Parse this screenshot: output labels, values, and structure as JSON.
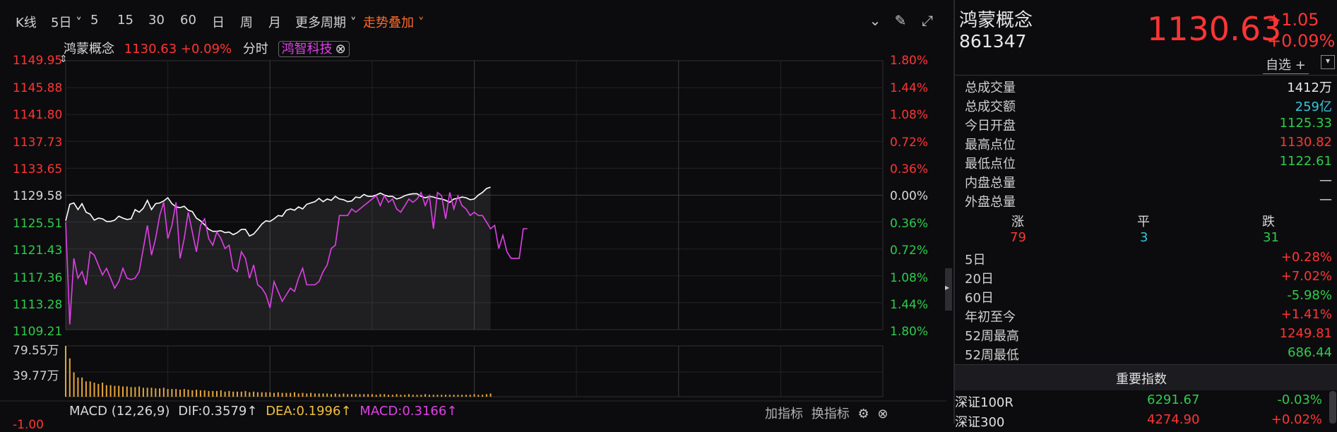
{
  "toolbar": {
    "kline": "K线",
    "period_5d": "5日",
    "items": [
      "5",
      "15",
      "30",
      "60",
      "日",
      "周",
      "月"
    ],
    "more_periods": "更多周期",
    "trend_overlay": "走势叠加"
  },
  "chart_header": {
    "name": "鸿蒙概念",
    "price_change": "1130.63 +0.09%",
    "mode": "分时",
    "overlay_tag": "鸿智科技"
  },
  "price_axis_left": [
    "1149.95",
    "1145.88",
    "1141.80",
    "1137.73",
    "1133.65",
    "1129.58",
    "1125.51",
    "1121.43",
    "1117.36",
    "1113.28",
    "1109.21"
  ],
  "price_axis_right": [
    "1.80%",
    "1.44%",
    "1.08%",
    "0.72%",
    "0.36%",
    "0.00%",
    "0.36%",
    "0.72%",
    "1.08%",
    "1.44%",
    "1.80%"
  ],
  "volume_axis": [
    "79.55万",
    "39.77万"
  ],
  "macd_axis_partial": "-1.00",
  "macd": {
    "name": "MACD",
    "params": "(12,26,9)",
    "dif": "DIF:0.3579",
    "dea": "DEA:0.1996",
    "macd_val": "MACD:0.3166",
    "arrow": "↑",
    "add_indicator": "加指标",
    "switch_indicator": "换指标"
  },
  "quote": {
    "name": "鸿蒙概念",
    "code": "861347",
    "price": "1130.63",
    "change": "+1.05",
    "change_pct": "+0.09%",
    "watchlist": "自选 +"
  },
  "stats": [
    {
      "label": "总成交量",
      "value": "1412万",
      "color": "white"
    },
    {
      "label": "总成交额",
      "value": "259亿",
      "color": "cyan"
    },
    {
      "label": "今日开盘",
      "value": "1125.33",
      "color": "green"
    },
    {
      "label": "最高点位",
      "value": "1130.82",
      "color": "red"
    },
    {
      "label": "最低点位",
      "value": "1122.61",
      "color": "green"
    },
    {
      "label": "内盘总量",
      "value": "—",
      "color": "white"
    },
    {
      "label": "外盘总量",
      "value": "—",
      "color": "white"
    }
  ],
  "breadth": {
    "up_label": "涨",
    "flat_label": "平",
    "down_label": "跌",
    "up": "79",
    "flat": "3",
    "down": "31"
  },
  "performance": [
    {
      "label": "5日",
      "value": "+0.28%",
      "color": "red"
    },
    {
      "label": "20日",
      "value": "+7.02%",
      "color": "red"
    },
    {
      "label": "60日",
      "value": "-5.98%",
      "color": "green"
    },
    {
      "label": "年初至今",
      "value": "+1.41%",
      "color": "red"
    },
    {
      "label": "52周最高",
      "value": "1249.81",
      "color": "red"
    },
    {
      "label": "52周最低",
      "value": "686.44",
      "color": "green"
    }
  ],
  "index_section": {
    "title": "重要指数",
    "rows": [
      {
        "name": "深证100R",
        "value": "6291.67",
        "change": "-0.03%",
        "value_color": "green",
        "change_color": "green"
      },
      {
        "name": "深证300",
        "value": "4274.90",
        "change": "+0.02%",
        "value_color": "red",
        "change_color": "red"
      }
    ]
  },
  "chart_data": {
    "type": "line",
    "ylim": [
      1109.21,
      1149.95
    ],
    "prev_close": 1129.58,
    "x": [
      0,
      1,
      2,
      3,
      4,
      5,
      6,
      7,
      8,
      9,
      10,
      11,
      12,
      13,
      14,
      15,
      16,
      17,
      18,
      19,
      20,
      21,
      22,
      23,
      24,
      25,
      26,
      27,
      28,
      29,
      30,
      31,
      32,
      33,
      34,
      35,
      36,
      37,
      38,
      39,
      40,
      41,
      42,
      43,
      44,
      45,
      46,
      47,
      48,
      49,
      50,
      51,
      52,
      53,
      54,
      55,
      56,
      57,
      58,
      59,
      60,
      61,
      62,
      63,
      64,
      65,
      66,
      67,
      68,
      69,
      70,
      71,
      72,
      73,
      74,
      75,
      76,
      77,
      78,
      79,
      80,
      81,
      82,
      83,
      84,
      85,
      86,
      87,
      88,
      89,
      90,
      91,
      92,
      93,
      94,
      95,
      96,
      97,
      98,
      99,
      100,
      101,
      102,
      103,
      104,
      105,
      106,
      107,
      108,
      109,
      110,
      111,
      112,
      113,
      114,
      115,
      116,
      117,
      118,
      119
    ],
    "series": [
      {
        "name": "鸿蒙概念",
        "color": "#ffffff",
        "values": [
          1125.7,
          1128.2,
          1128.4,
          1127.4,
          1128.3,
          1127.0,
          1126.7,
          1125.8,
          1126.1,
          1126.0,
          1125.6,
          1125.6,
          1125.8,
          1126.4,
          1126.1,
          1125.9,
          1126.0,
          1127.4,
          1127.0,
          1127.6,
          1128.8,
          1127.4,
          1128.3,
          1128.4,
          1128.7,
          1129.2,
          1128.3,
          1127.8,
          1127.7,
          1127.9,
          1127.3,
          1127.1,
          1126.1,
          1125.7,
          1125.1,
          1124.4,
          1124.1,
          1124.1,
          1124.2,
          1123.9,
          1124.0,
          1123.6,
          1123.9,
          1124.4,
          1124.4,
          1123.4,
          1123.7,
          1124.4,
          1125.2,
          1125.7,
          1125.6,
          1126.0,
          1126.5,
          1126.4,
          1127.3,
          1127.5,
          1127.3,
          1127.8,
          1127.5,
          1128.2,
          1128.4,
          1128.6,
          1129.1,
          1128.6,
          1129.0,
          1128.8,
          1129.4,
          1129.0,
          1128.9,
          1128.6,
          1128.7,
          1129.3,
          1129.2,
          1129.7,
          1129.4,
          1129.4,
          1129.6,
          1129.9,
          1129.6,
          1129.4,
          1129.4,
          1129.0,
          1129.2,
          1129.5,
          1129.7,
          1129.8,
          1129.8,
          1129.4,
          1129.2,
          1129.4,
          1129.3,
          1129.1,
          1129.0,
          1128.8,
          1128.5,
          1129.0,
          1129.1,
          1129.3,
          1129.2,
          1128.9,
          1129.0,
          1129.6,
          1130.0,
          1130.6,
          1130.8
        ]
      },
      {
        "name": "鸿智科技",
        "color": "#e040e8",
        "values": [
          1125.5,
          1110.0,
          1120.0,
          1117.0,
          1118.0,
          1116.0,
          1121.0,
          1120.5,
          1119.0,
          1117.5,
          1118.5,
          1117.0,
          1115.5,
          1116.5,
          1118.5,
          1117.0,
          1116.8,
          1117.0,
          1118.0,
          1121.5,
          1125.0,
          1120.5,
          1123.0,
          1126.5,
          1128.5,
          1123.0,
          1125.0,
          1128.5,
          1120.0,
          1123.0,
          1127.0,
          1124.0,
          1121.0,
          1125.0,
          1126.0,
          1123.0,
          1122.0,
          1124.0,
          1123.0,
          1121.5,
          1122.0,
          1118.5,
          1118.0,
          1121.0,
          1120.0,
          1117.0,
          1119.0,
          1116.0,
          1115.5,
          1114.5,
          1112.5,
          1116.5,
          1115.0,
          1113.5,
          1114.5,
          1115.5,
          1115.0,
          1117.0,
          1118.5,
          1116.0,
          1116.0,
          1116.0,
          1116.5,
          1118.0,
          1119.0,
          1121.5,
          1122.0,
          1126.5,
          1126.5,
          1126.5,
          1127.5,
          1127.0,
          1127.5,
          1128.0,
          1128.5,
          1129.0,
          1129.5,
          1128.0,
          1129.5,
          1128.5,
          1129.0,
          1127.5,
          1127.0,
          1128.0,
          1129.0,
          1128.5,
          1129.0,
          1130.0,
          1128.0,
          1129.5,
          1124.5,
          1130.0,
          1129.5,
          1126.0,
          1130.0,
          1127.5,
          1129.5,
          1128.0,
          1127.5,
          1126.5,
          1127.0,
          1126.5,
          1126.5,
          1125.5,
          1124.5,
          1125.0,
          1121.5,
          1123.5,
          1121.0,
          1120.0,
          1120.0,
          1120.0,
          1124.5,
          1124.5
        ]
      }
    ],
    "volume": [
      79.5,
      60.0,
      38.0,
      30.0,
      30.0,
      24.0,
      24.0,
      22.0,
      20.0,
      22.0,
      18.0,
      18.0,
      17.0,
      17.0,
      16.0,
      16.0,
      15.0,
      15.0,
      16.0,
      14.0,
      14.0,
      14.0,
      13.0,
      13.0,
      14.0,
      12.0,
      12.0,
      12.0,
      11.0,
      12.0,
      11.0,
      10.0,
      11.0,
      10.0,
      10.0,
      9.0,
      9.0,
      9.0,
      10.0,
      8.0,
      9.0,
      8.0,
      8.0,
      8.0,
      9.0,
      7.0,
      8.0,
      7.0,
      7.0,
      7.0,
      7.0,
      6.0,
      7.0,
      6.0,
      6.0,
      6.0,
      7.0,
      5.0,
      6.0,
      5.0,
      6.0,
      5.0,
      5.0,
      5.0,
      5.0,
      4.0,
      5.0,
      4.0,
      5.0,
      4.0,
      4.0,
      4.0,
      4.0,
      4.0,
      4.0,
      4.0,
      3.0,
      4.0,
      4.0,
      3.0,
      3.0,
      4.0,
      3.0,
      3.0,
      4.0,
      3.0,
      3.0,
      3.0,
      4.0,
      3.0,
      3.0,
      3.0,
      3.0,
      3.0,
      3.0,
      3.0,
      3.0,
      3.0,
      3.0,
      3.0,
      4.0,
      3.0,
      3.0,
      4.0,
      5.0
    ]
  },
  "colors": {
    "up": "#ff3535",
    "down": "#2ecc4d",
    "accent": "#ff6a2a",
    "overlay": "#e040e8",
    "macd_dea": "#f0c040"
  }
}
